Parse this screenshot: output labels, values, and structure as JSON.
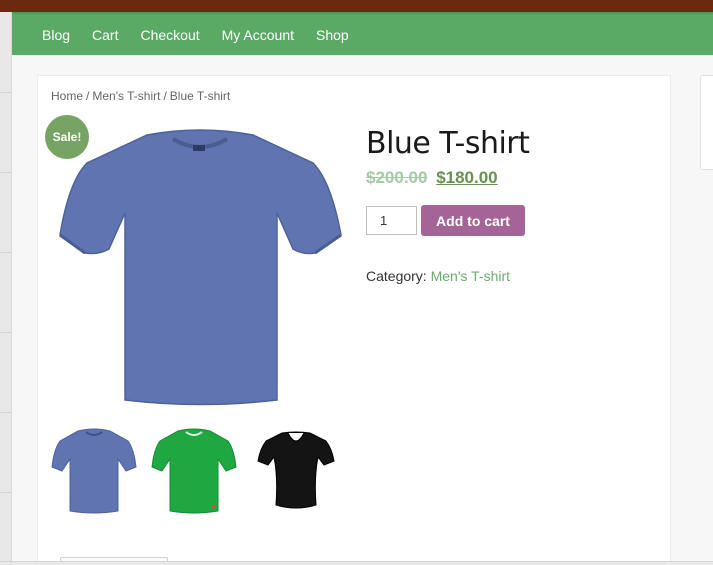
{
  "nav": {
    "items": [
      "Blog",
      "Cart",
      "Checkout",
      "My Account",
      "Shop"
    ]
  },
  "breadcrumb": {
    "home": "Home",
    "category": "Men's T-shirt",
    "current": "Blue T-shirt",
    "separator": "/"
  },
  "product": {
    "sale_badge": "Sale!",
    "title": "Blue T-shirt",
    "old_price": "$200.00",
    "new_price": "$180.00",
    "quantity": "1",
    "add_to_cart_label": "Add to cart",
    "category_label": "Category:",
    "category_value": "Men's T-shirt"
  },
  "colors": {
    "nav_bg": "#5aaa66",
    "sale_badge": "#77a464",
    "button": "#a46497",
    "link_green": "#6cab6e",
    "shirt_blue": "#5f74b0",
    "shirt_green": "#1fa842",
    "shirt_black": "#141414"
  },
  "icons": {
    "main_image": "blue-tshirt-image",
    "thumbnails": [
      "blue-tshirt-thumb",
      "green-tshirt-thumb",
      "black-womens-tshirt-thumb"
    ]
  }
}
